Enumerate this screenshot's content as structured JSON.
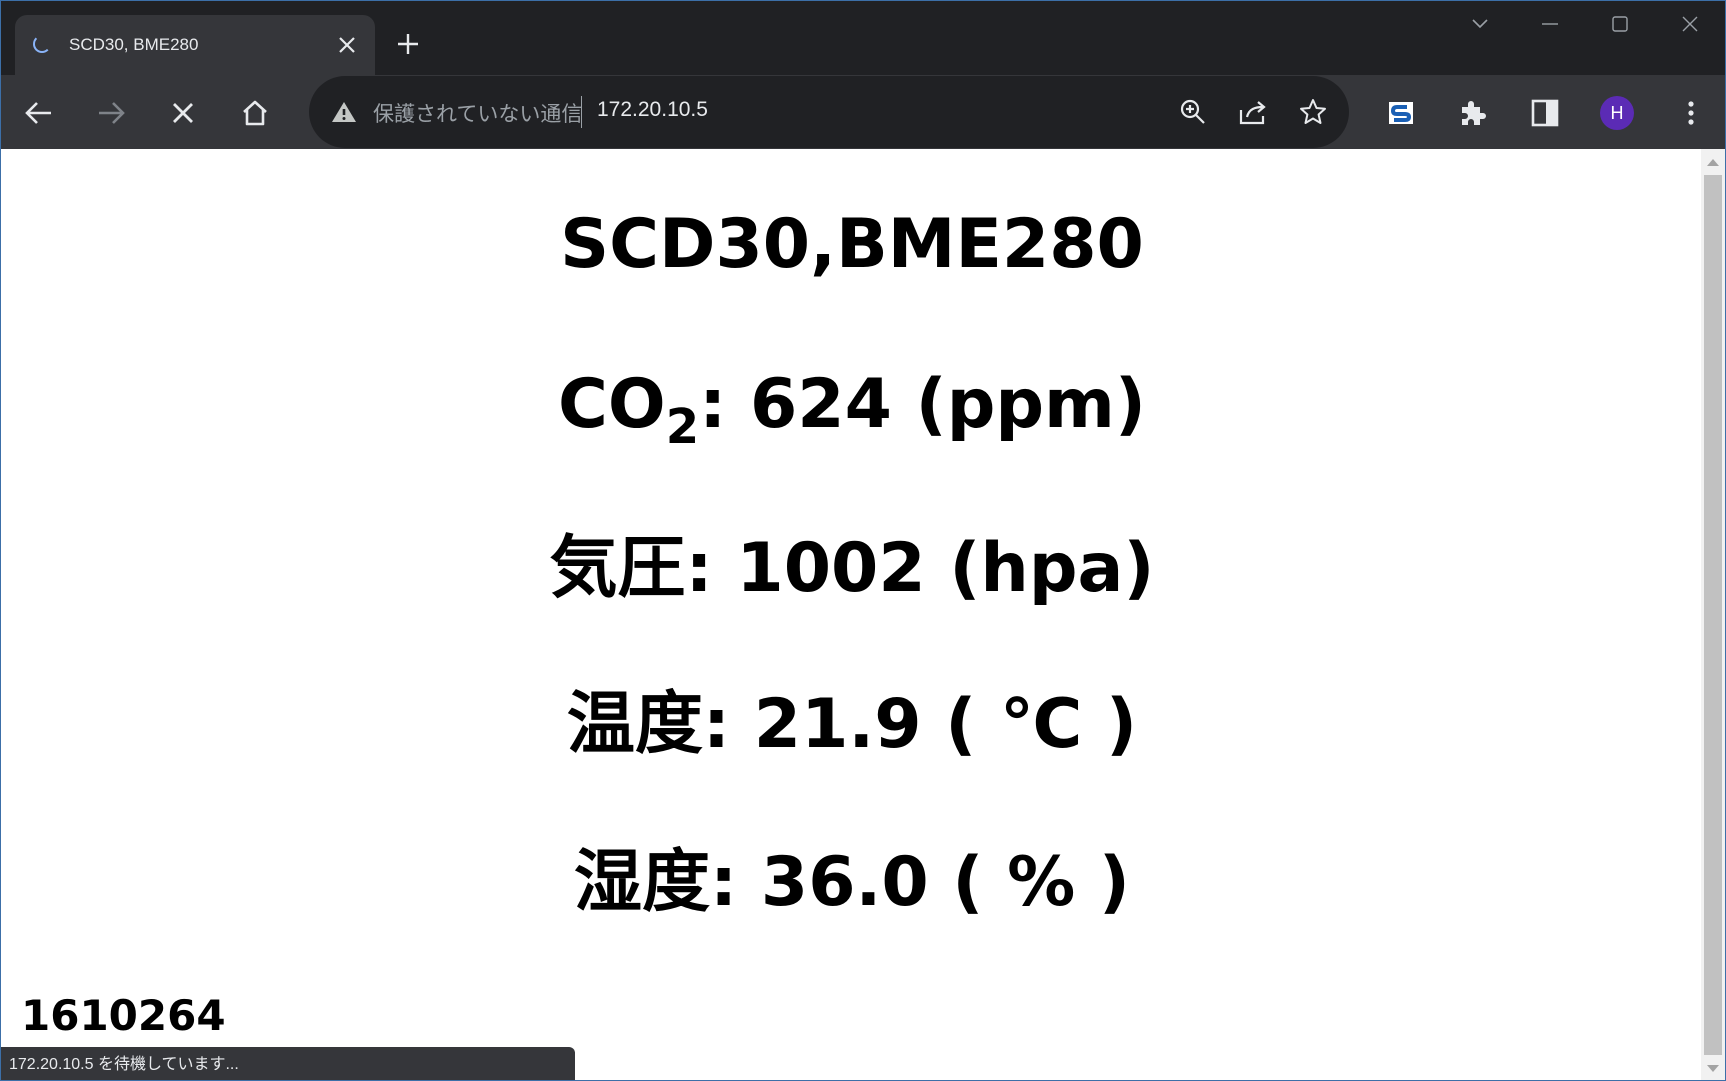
{
  "browser": {
    "tab": {
      "title": "SCD30, BME280"
    },
    "omnibox": {
      "security_label": "保護されていない通信",
      "url": "172.20.10.5"
    },
    "avatar_letter": "H",
    "status_text": "172.20.10.5 を待機しています..."
  },
  "page": {
    "title": "SCD30,BME280",
    "co2": {
      "label_main": "CO",
      "label_sub": "2",
      "text": ": 624 (ppm)"
    },
    "pressure": "気圧: 1002 (hpa)",
    "temperature": "温度: 21.9 ( ℃ )",
    "humidity": "湿度: 36.0 ( % )",
    "counter": "1610264"
  },
  "colors": {
    "accent_avatar": "#5b2bb5",
    "toolbar": "#35363a",
    "tabstrip": "#202124"
  },
  "icons": [
    "tab-loading-spinner-icon",
    "close-icon",
    "plus-icon",
    "chevron-down-icon",
    "minimize-icon",
    "maximize-icon",
    "back-arrow-icon",
    "forward-arrow-icon",
    "stop-icon",
    "home-icon",
    "warning-icon",
    "zoom-icon",
    "share-icon",
    "star-icon",
    "extension-s-icon",
    "puzzle-icon",
    "side-panel-icon",
    "kebab-menu-icon"
  ]
}
